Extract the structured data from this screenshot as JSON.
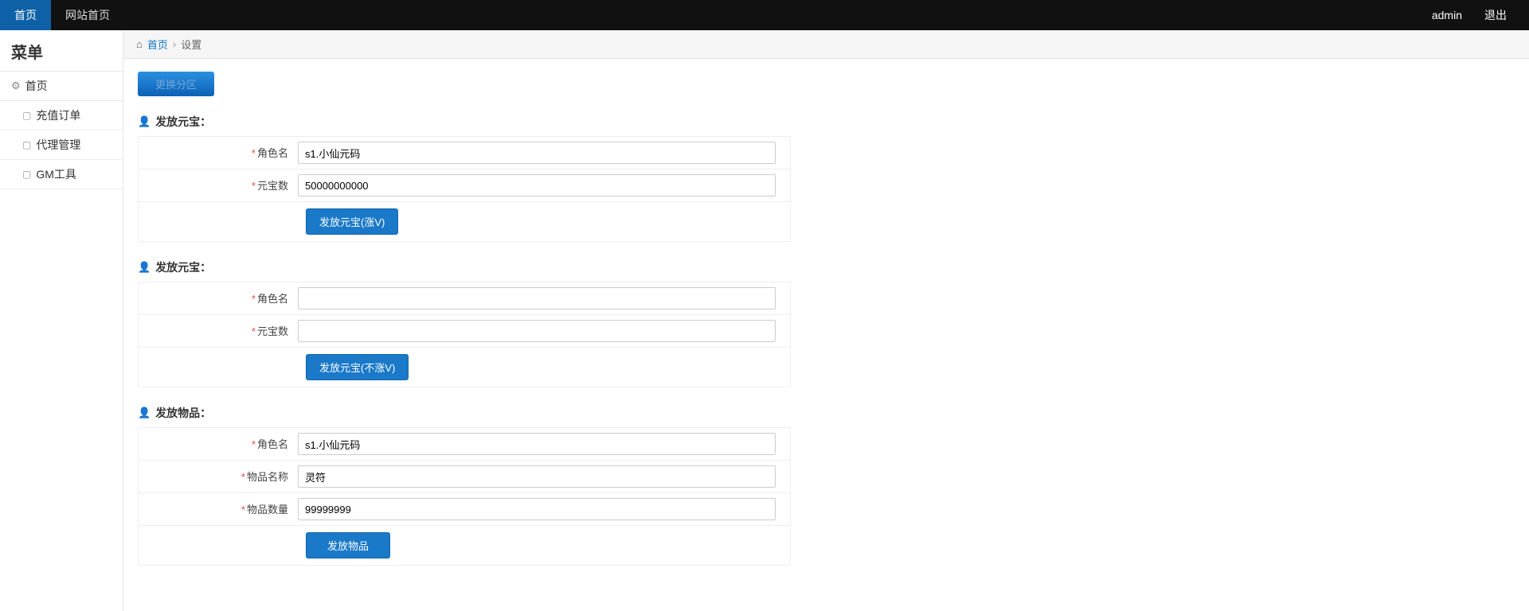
{
  "topbar": {
    "left": [
      {
        "label": "首页",
        "active": true
      },
      {
        "label": "网站首页",
        "active": false
      }
    ],
    "right": {
      "user": "admin",
      "logout": "退出"
    }
  },
  "sidebar": {
    "title": "菜单",
    "panel_head": "首页",
    "items": [
      {
        "label": "充值订单"
      },
      {
        "label": "代理管理"
      },
      {
        "label": "GM工具"
      }
    ]
  },
  "breadcrumb": {
    "home": "首页",
    "current": "设置"
  },
  "region_btn": "更换分区",
  "sections": {
    "s1": {
      "title": "发放元宝：",
      "role_label": "角色名",
      "role_value": "s1.小仙元码",
      "amount_label": "元宝数",
      "amount_value": "50000000000",
      "submit": "发放元宝(涨V)"
    },
    "s2": {
      "title": "发放元宝：",
      "role_label": "角色名",
      "role_value": "",
      "amount_label": "元宝数",
      "amount_value": "",
      "submit": "发放元宝(不涨V)"
    },
    "s3": {
      "title": "发放物品：",
      "role_label": "角色名",
      "role_value": "s1.小仙元码",
      "itemname_label": "物品名称",
      "itemname_value": "灵符",
      "qty_label": "物品数量",
      "qty_value": "99999999",
      "submit": "发放物品"
    }
  }
}
